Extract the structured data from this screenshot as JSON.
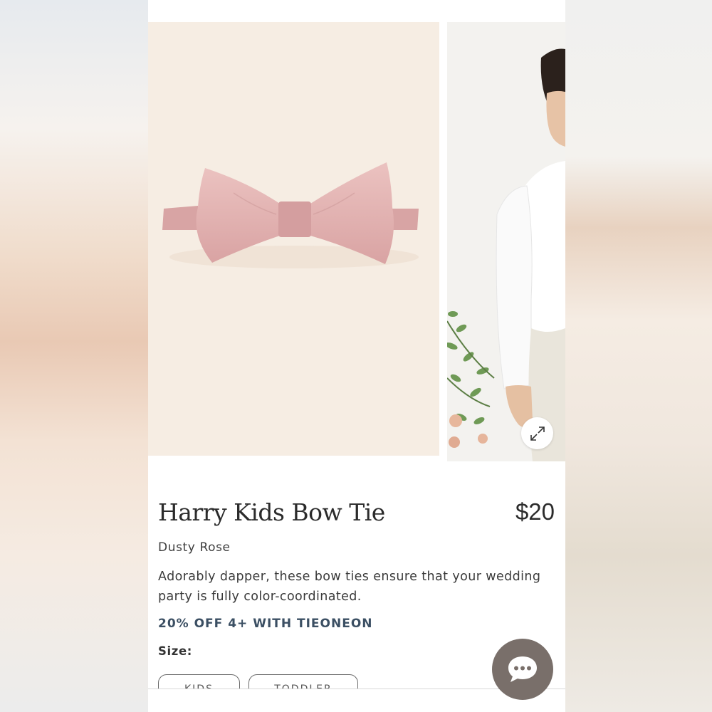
{
  "product": {
    "title": "Harry Kids Bow Tie",
    "price": "$20",
    "color": "Dusty Rose",
    "description": "Adorably dapper, these bow ties ensure that your wedding party is fully color-coordinated.",
    "promo": "20% OFF 4+ WITH TIEONEON",
    "size_label": "Size:",
    "sizes": [
      "KIDS",
      "TODDLER"
    ]
  },
  "gallery": {
    "main_image": "bow-tie-product-photo",
    "secondary_image": "boy-in-white-shirt-photo",
    "expand_icon": "expand-arrows-icon"
  },
  "chat": {
    "icon": "chat-bubble-icon"
  },
  "colors": {
    "accent_promo": "#3b4f63",
    "main_image_bg": "#f6ede3",
    "bow_tie": "#e2b1b0",
    "chat_button": "#796f6a",
    "text": "#2b2b2b"
  }
}
